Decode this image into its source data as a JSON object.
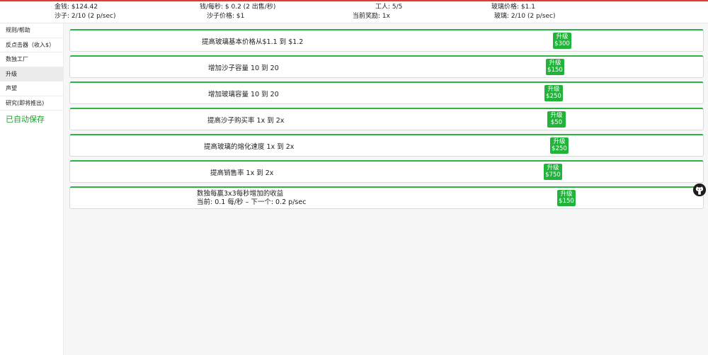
{
  "stats": {
    "money": "金钱: $124.42",
    "money_per_sec": "钱/每秒: $ 0.2 (2 出售/秒)",
    "workers": "工人:  5/5",
    "glass_price": "玻璃价格: $1.1",
    "sand": "沙子:   2/10 (2 p/sec)",
    "sand_price": "沙子价格: $1",
    "current_bonus": "当前奖励:    1x",
    "glass": "玻璃:   2/10 (2 p/sec)"
  },
  "sidebar": {
    "items": [
      "规则/帮助",
      "反点击器（收入$）",
      "数独工厂",
      "升级",
      "声望",
      "研究(即将推出)"
    ],
    "autosave": "已自动保存"
  },
  "upgrades": [
    {
      "title": "提高玻璃基本价格从$1.1 到 $1.2",
      "btn_label": "升级",
      "btn_price": "$300"
    },
    {
      "title": "增加沙子容量 10 到 20",
      "btn_label": "升级",
      "btn_price": "$150"
    },
    {
      "title": "增加玻璃容量 10 到 20",
      "btn_label": "升级",
      "btn_price": "$250"
    },
    {
      "title": "提高沙子购买率 1x 到 2x",
      "btn_label": "升级",
      "btn_price": "$50"
    },
    {
      "title": "提高玻璃的熔化速度 1x 到 2x",
      "btn_label": "升级",
      "btn_price": "$250"
    },
    {
      "title": "提高销售率 1x 到 2x",
      "btn_label": "升级",
      "btn_price": "$750"
    },
    {
      "title": "数独每赢3x3每秒增加的收益",
      "subtitle": "当前:   0.1 每/秒 – 下一个:   0.2 p/sec",
      "btn_label": "升级",
      "btn_price": "$150"
    }
  ],
  "icons": {
    "github": "github-icon"
  },
  "colors": {
    "accent_green": "#21b33a",
    "top_line": "#e53935"
  }
}
